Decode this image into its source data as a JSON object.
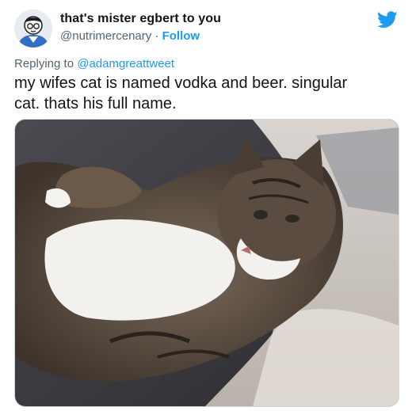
{
  "author": {
    "display_name": "that's mister egbert to you",
    "handle": "@nutrimercenary",
    "separator": "·",
    "follow_label": "Follow"
  },
  "reply": {
    "prefix": "Replying to",
    "mention": "@adamgreattweet"
  },
  "tweet": {
    "line1": "my wifes cat is named vodka and beer. singular",
    "line2": "cat. thats his full name."
  },
  "icons": {
    "brand": "twitter-bird-icon",
    "avatar": "cartoon-avatar"
  },
  "media": {
    "subject": "tabby and white cat lying on a blanket"
  },
  "colors": {
    "accent": "#1d9bf0",
    "secondary_text": "#536471",
    "primary_text": "#0f1419"
  }
}
